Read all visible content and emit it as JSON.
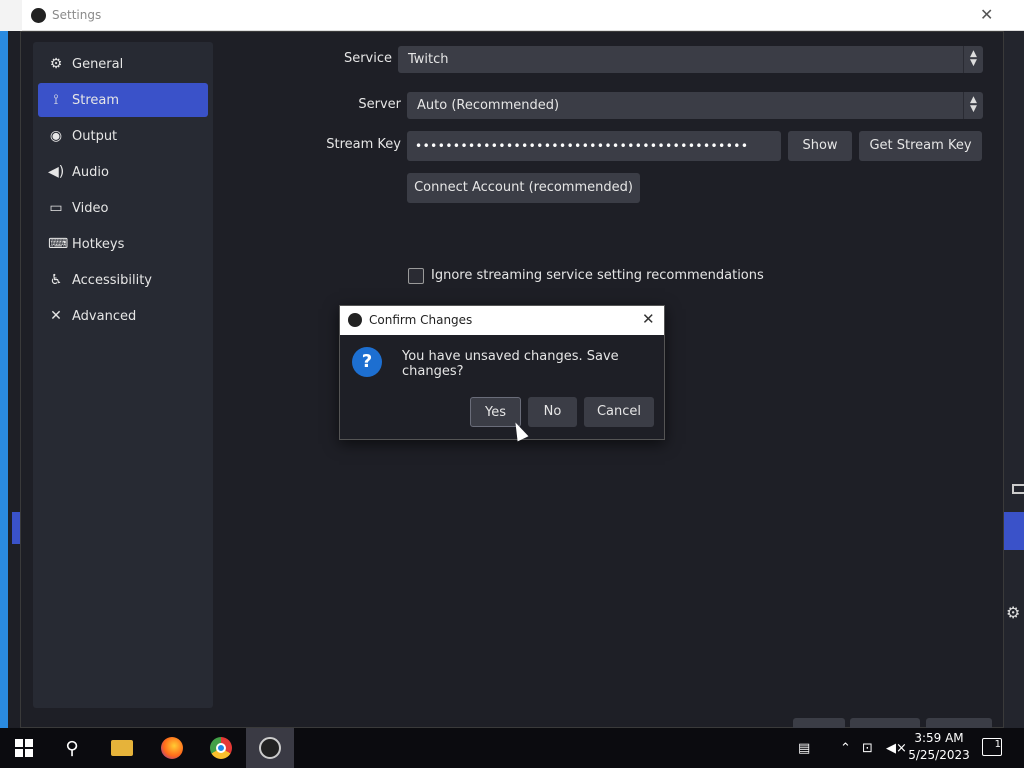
{
  "window": {
    "title": "Settings"
  },
  "sidebar": {
    "items": [
      {
        "label": "General",
        "icon": "gear-icon"
      },
      {
        "label": "Stream",
        "icon": "antenna-icon",
        "active": true
      },
      {
        "label": "Output",
        "icon": "output-icon"
      },
      {
        "label": "Audio",
        "icon": "speaker-icon"
      },
      {
        "label": "Video",
        "icon": "monitor-icon"
      },
      {
        "label": "Hotkeys",
        "icon": "keyboard-icon"
      },
      {
        "label": "Accessibility",
        "icon": "accessibility-icon"
      },
      {
        "label": "Advanced",
        "icon": "wrench-icon"
      }
    ]
  },
  "stream": {
    "service_label": "Service",
    "service_value": "Twitch",
    "server_label": "Server",
    "server_value": "Auto (Recommended)",
    "key_label": "Stream Key",
    "key_value": "••••••••••••••••••••••••••••••••••••••••••••",
    "show_label": "Show",
    "get_key_label": "Get Stream Key",
    "connect_label": "Connect Account (recommended)",
    "ignore_label": "Ignore streaming service setting recommendations",
    "ignore_checked": false
  },
  "dialog": {
    "title": "Confirm Changes",
    "message": "You have unsaved changes. Save changes?",
    "yes_label": "Yes",
    "no_label": "No",
    "cancel_label": "Cancel"
  },
  "taskbar": {
    "time": "3:59 AM",
    "date": "5/25/2023",
    "notification_count": "1"
  },
  "colors": {
    "accent": "#3a52c9",
    "background": "#1e1f26",
    "panel": "#272a33",
    "control": "#3b3d46"
  }
}
